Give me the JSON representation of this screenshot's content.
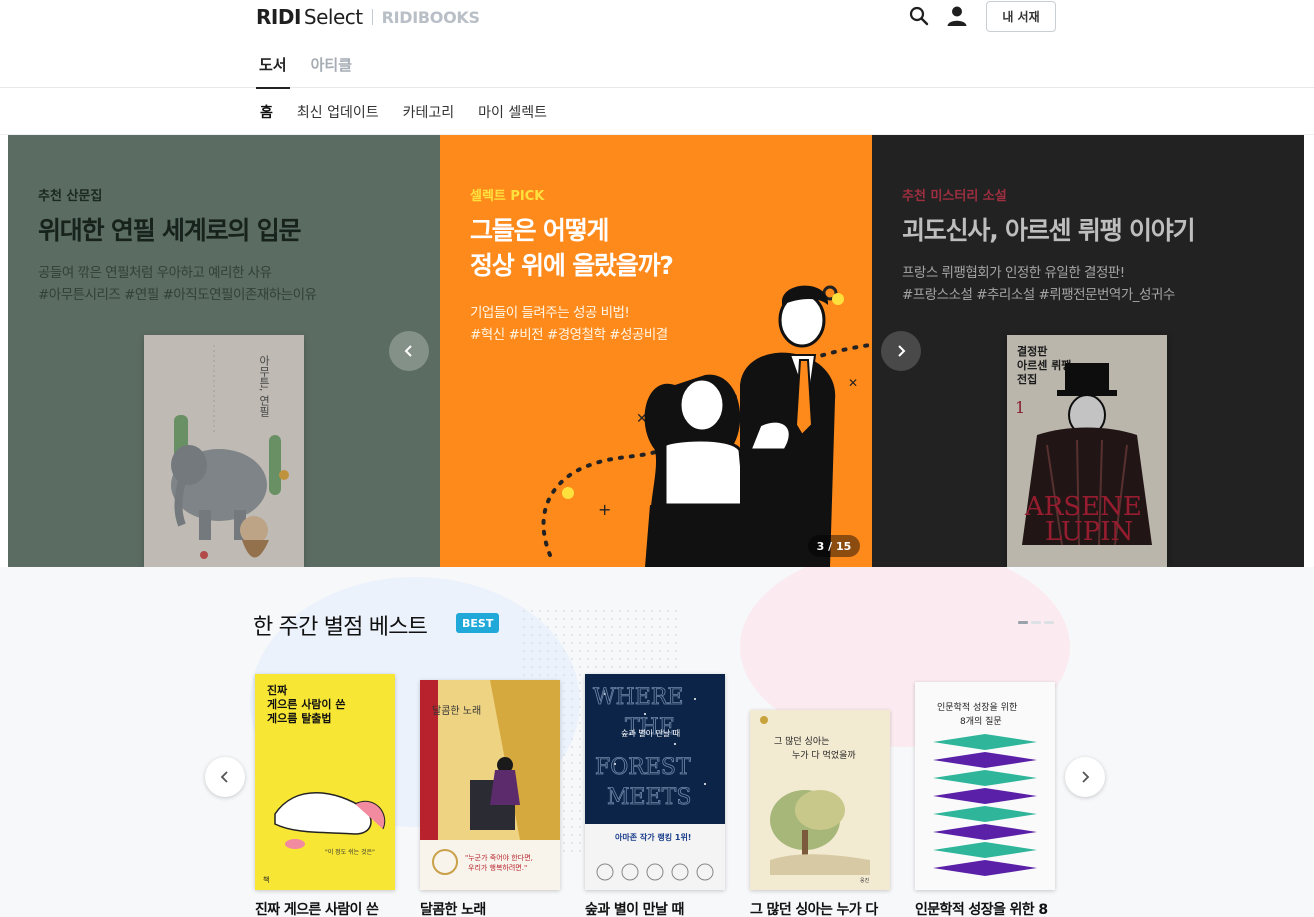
{
  "header": {
    "logo_ridi": "RIDI",
    "logo_select": "Select",
    "logo_books": "RIDIBOOKS",
    "shelf_button": "내 서재",
    "main_tabs": [
      {
        "label": "도서",
        "active": true
      },
      {
        "label": "아티클",
        "active": false
      }
    ]
  },
  "subnav": {
    "items": [
      {
        "label": "홈",
        "active": true
      },
      {
        "label": "최신 업데이트",
        "active": false
      },
      {
        "label": "카테고리",
        "active": false
      },
      {
        "label": "마이 셀렉트",
        "active": false
      }
    ]
  },
  "carousel": {
    "counter": "3 / 15",
    "slides": [
      {
        "label": "추천 산문집",
        "title": "위대한 연필 세계로의 입문",
        "desc": "공들여 깎은 연필처럼 우아하고 예리한 사유\n#아무튼시리즈 #연필 #아직도연필이존재하는이유",
        "bg": "#6f8478"
      },
      {
        "label": "셀렉트 PICK",
        "title": "그들은 어떻게\n정상 위에 올랐을까?",
        "desc": "기업들이 들려주는 성공 비법!\n#혁신 #비전 #경영철학 #성공비결",
        "bg": "#ff8a1c"
      },
      {
        "label": "추천 미스터리 소설",
        "title": "괴도신사, 아르센 뤼팽 이야기",
        "desc": "프랑스 뤼팽협회가 인정한 유일한 결정판!\n#프랑스소설 #추리소설 #뤼팽전문번역가_성귀수",
        "bg": "#2a2a2a"
      }
    ]
  },
  "best": {
    "title": "한 주간 별점 베스트",
    "badge": "BEST",
    "books": [
      {
        "title": "진짜 게으른 사람이 쓴",
        "cover_text": "진짜\n게으른 사람이 쓴\n게으름 탈출법",
        "cover_bg": "#f7e634"
      },
      {
        "title": "달콤한 노래",
        "cover_text": "달콤한 노래",
        "cover_bg": "#ecd27a"
      },
      {
        "title": "숲과 별이 만날 때",
        "cover_text": "숲과 별이 만날 때",
        "cover_bg": "#0c2447"
      },
      {
        "title": "그 많던 싱아는 누가 다",
        "cover_text": "그 많던 싱아는\n누가 다 먹었을까",
        "cover_bg": "#f3ead2"
      },
      {
        "title": "인문학적 성장을 위한 8",
        "cover_text": "인문학적 성장을 위한\n8개의 질문",
        "cover_bg": "#fafafa"
      }
    ]
  },
  "colors": {
    "accent_blue": "#1fa8d8",
    "orange": "#ff8a1c"
  }
}
